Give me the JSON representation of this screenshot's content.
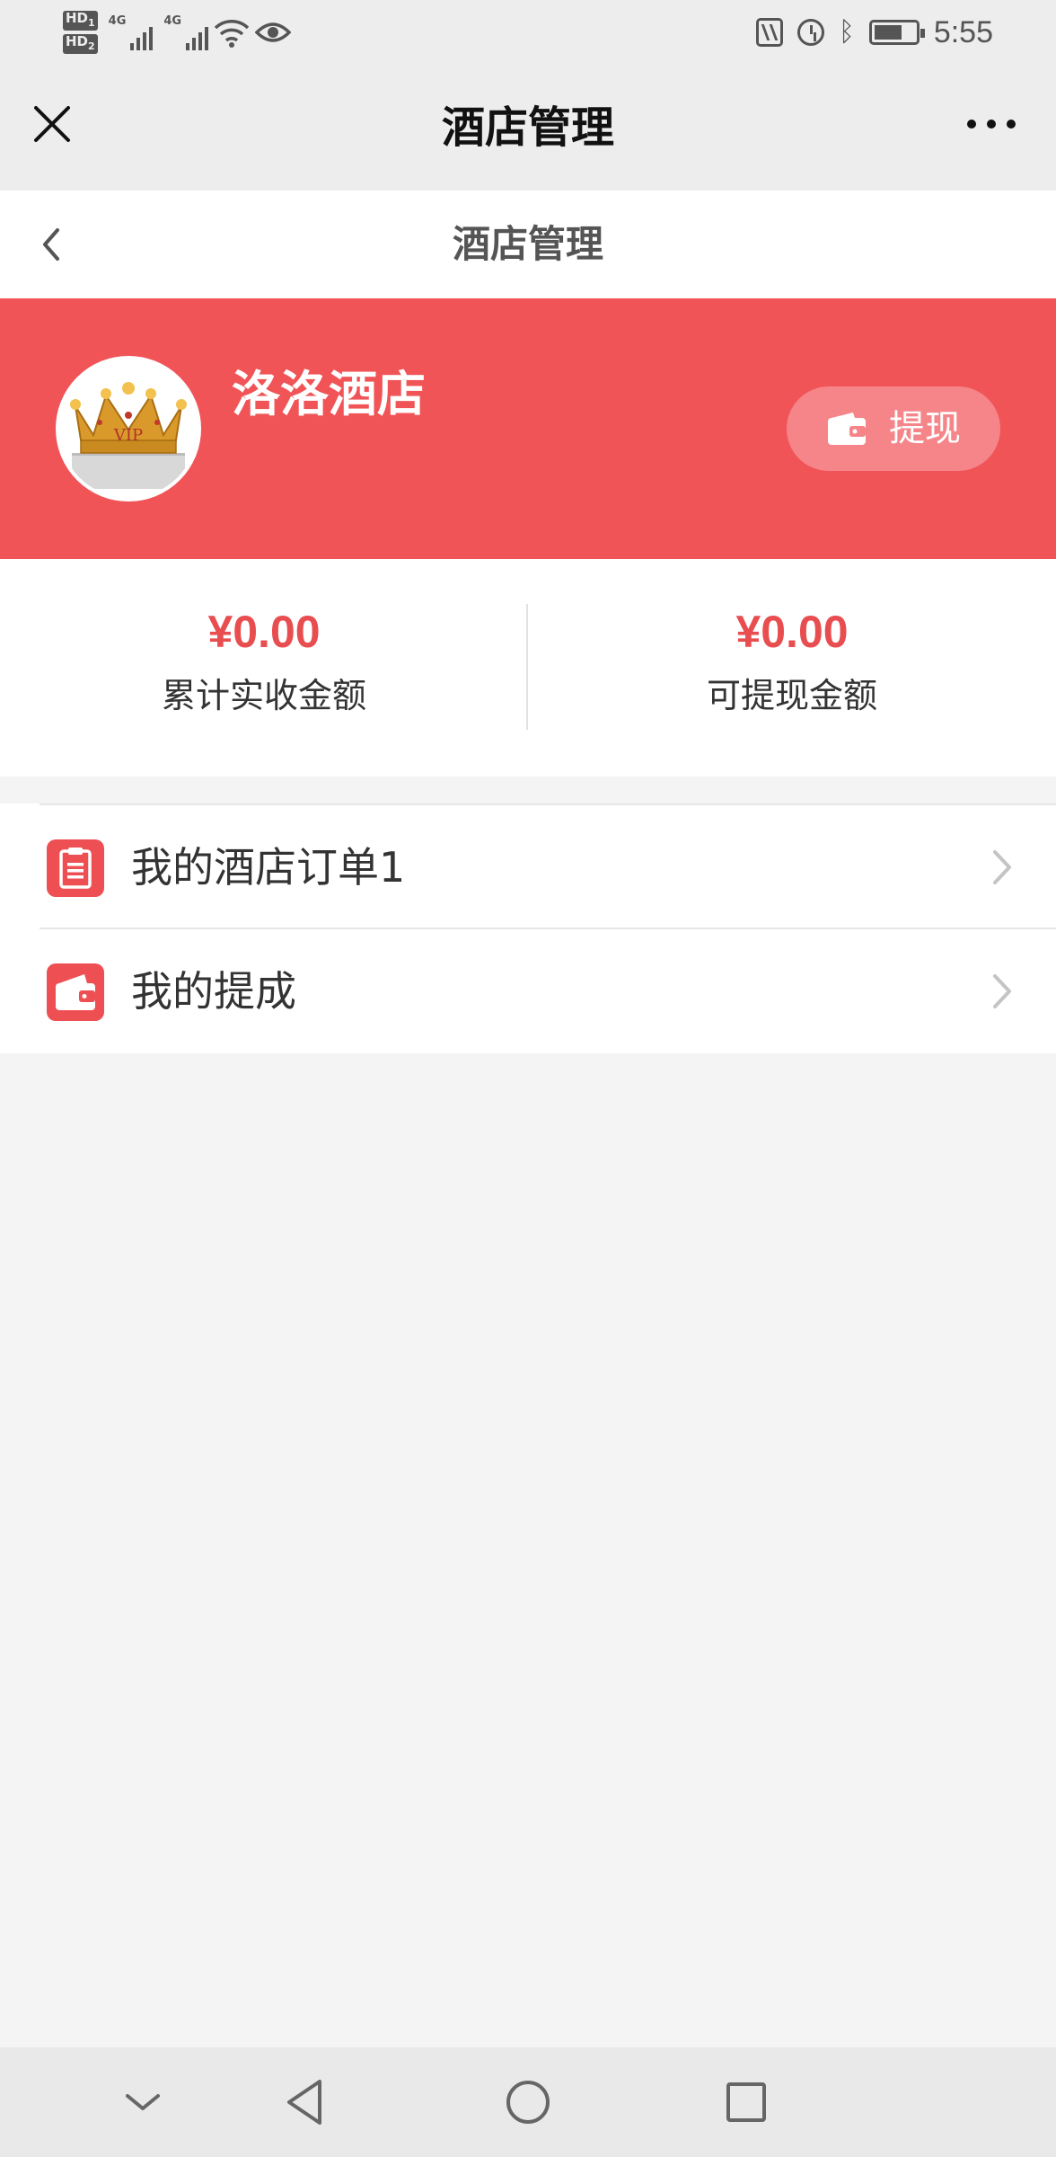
{
  "status_bar": {
    "sim1": "HD",
    "sim1_sub": "1",
    "sim2": "HD",
    "sim2_sub": "2",
    "network1": "4G",
    "network2": "4G",
    "time": "5:55",
    "icons": [
      "nfc-icon",
      "alarm-icon",
      "bluetooth-icon",
      "battery-icon"
    ]
  },
  "topbar": {
    "title": "酒店管理",
    "close_icon": "close-icon",
    "more_icon": "more-icon"
  },
  "page_header": {
    "title": "酒店管理",
    "back_icon": "chevron-left-icon"
  },
  "banner": {
    "hotel_name": "洛洛酒店",
    "avatar_text": "VIP",
    "withdraw_label": "提现",
    "background_color": "#f05457"
  },
  "stats": [
    {
      "value": "¥0.00",
      "label": "累计实收金额"
    },
    {
      "value": "¥0.00",
      "label": "可提现金额"
    }
  ],
  "menu": [
    {
      "label": "我的酒店订单1",
      "icon": "clipboard-icon"
    },
    {
      "label": "我的提成",
      "icon": "wallet-icon"
    }
  ],
  "nav_bar": {
    "buttons": [
      "collapse-icon",
      "back-icon",
      "home-icon",
      "recents-icon"
    ]
  },
  "colors": {
    "accent": "#e84d50",
    "banner": "#f05457",
    "withdraw_button": "#f58588"
  }
}
